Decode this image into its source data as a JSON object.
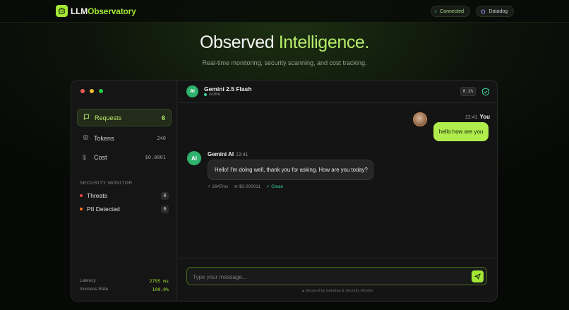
{
  "brand": {
    "name_part1": "LLM",
    "name_part2": "Observatory",
    "icon": "robot-icon",
    "accent": "#a3e635"
  },
  "topnav": {
    "connected_label": "Connected",
    "datadog_label": "Datadog"
  },
  "hero": {
    "title_part1": "Observed ",
    "title_part2": "Intelligence.",
    "subtitle": "Real-time monitoring, security scanning, and cost tracking."
  },
  "sidebar": {
    "nav": [
      {
        "label": "Requests",
        "value": "6",
        "icon": "chat-icon",
        "active": true
      },
      {
        "label": "Tokens",
        "value": "240",
        "icon": "chip-icon",
        "active": false
      },
      {
        "label": "Cost",
        "value": "$0.0001",
        "icon": "dollar-icon",
        "active": false
      }
    ],
    "security_heading": "SECURITY MONITOR",
    "security_items": [
      {
        "label": "Threats",
        "count": "0",
        "color": "#ef4444"
      },
      {
        "label": "PII Detected",
        "count": "0",
        "color": "#f97316"
      }
    ],
    "stats": [
      {
        "label": "Latency",
        "value": "2795 ms"
      },
      {
        "label": "Success Rate",
        "value": "100.0%"
      }
    ]
  },
  "chat": {
    "model_avatar": "AI",
    "model_name": "Gemini 2.5 Flash",
    "model_status": "Active",
    "score_badge": "0.2%",
    "messages": {
      "user": {
        "time": "22:41",
        "author": "You",
        "text": "hello how are you"
      },
      "ai": {
        "avatar": "AI",
        "author": "Gemini AI",
        "time": "22:41",
        "text": "Hello! I'm doing well, thank you for asking. How are you today?",
        "latency": "2647ms",
        "cost": "$0.000011",
        "status": "Clean"
      }
    },
    "input_placeholder": "Type your message...",
    "secured_text": "Secured by Datadog & Security Monitor"
  }
}
